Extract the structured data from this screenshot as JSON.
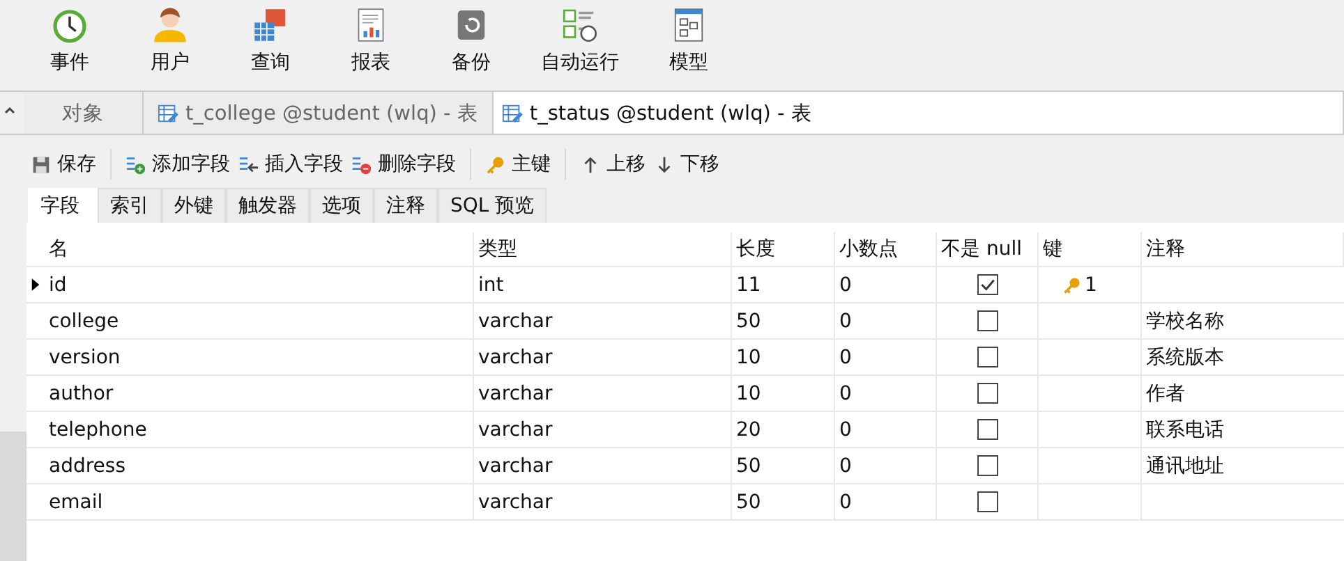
{
  "toolbar": [
    {
      "label": "事件",
      "kind": "clock"
    },
    {
      "label": "用户",
      "kind": "user"
    },
    {
      "label": "查询",
      "kind": "query"
    },
    {
      "label": "报表",
      "kind": "report"
    },
    {
      "label": "备份",
      "kind": "backup"
    },
    {
      "label": "自动运行",
      "kind": "schedule"
    },
    {
      "label": "模型",
      "kind": "model"
    }
  ],
  "tabs": [
    {
      "label": "对象",
      "kind": "plain",
      "selected": false
    },
    {
      "label": "t_college @student (wlq) - 表",
      "kind": "table",
      "selected": false
    },
    {
      "label": "t_status @student (wlq) - 表",
      "kind": "table",
      "selected": true
    }
  ],
  "actions": [
    {
      "label": "保存",
      "kind": "save"
    },
    {
      "label": "添加字段",
      "kind": "add"
    },
    {
      "label": "插入字段",
      "kind": "insert"
    },
    {
      "label": "删除字段",
      "kind": "delete"
    },
    {
      "label": "主键",
      "kind": "key"
    },
    {
      "label": "上移",
      "kind": "up"
    },
    {
      "label": "下移",
      "kind": "down"
    }
  ],
  "field_tabs": [
    {
      "label": "字段",
      "selected": true
    },
    {
      "label": "索引",
      "selected": false
    },
    {
      "label": "外键",
      "selected": false
    },
    {
      "label": "触发器",
      "selected": false
    },
    {
      "label": "选项",
      "selected": false
    },
    {
      "label": "注释",
      "selected": false
    },
    {
      "label": "SQL 预览",
      "selected": false
    }
  ],
  "table": {
    "columns": [
      "名",
      "类型",
      "长度",
      "小数点",
      "不是 null",
      "键",
      "注释"
    ],
    "rows": [
      {
        "name": "id",
        "type": "int",
        "length": "11",
        "decimals": "0",
        "not_null": true,
        "key": "1",
        "comment": "",
        "selected": true
      },
      {
        "name": "college",
        "type": "varchar",
        "length": "50",
        "decimals": "0",
        "not_null": false,
        "comment": "学校名称",
        "selected": false
      },
      {
        "name": "version",
        "type": "varchar",
        "length": "10",
        "decimals": "0",
        "not_null": false,
        "comment": "系统版本",
        "selected": false
      },
      {
        "name": "author",
        "type": "varchar",
        "length": "10",
        "decimals": "0",
        "not_null": false,
        "comment": "作者",
        "selected": false
      },
      {
        "name": "telephone",
        "type": "varchar",
        "length": "20",
        "decimals": "0",
        "not_null": false,
        "comment": "联系电话",
        "selected": false
      },
      {
        "name": "address",
        "type": "varchar",
        "length": "50",
        "decimals": "0",
        "not_null": false,
        "comment": "通讯地址",
        "selected": false
      },
      {
        "name": "email",
        "type": "varchar",
        "length": "50",
        "decimals": "0",
        "not_null": false,
        "comment": "",
        "selected": false
      }
    ]
  }
}
